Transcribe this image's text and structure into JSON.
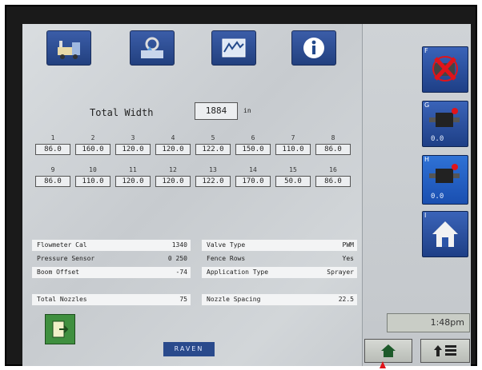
{
  "tabs": [
    {
      "name": "tab-machine",
      "icon": "machine-icon"
    },
    {
      "name": "tab-product",
      "icon": "product-settings-icon"
    },
    {
      "name": "tab-graph",
      "icon": "graph-icon"
    },
    {
      "name": "tab-info",
      "icon": "info-icon"
    }
  ],
  "width": {
    "label": "Total Width",
    "value": "1884",
    "unit": "in"
  },
  "sections_top": {
    "indices": [
      "1",
      "2",
      "3",
      "4",
      "5",
      "6",
      "7",
      "8"
    ],
    "values": [
      "86.0",
      "160.0",
      "120.0",
      "120.0",
      "122.0",
      "150.0",
      "110.0",
      "86.0"
    ]
  },
  "sections_bottom": {
    "indices": [
      "9",
      "10",
      "11",
      "12",
      "13",
      "14",
      "15",
      "16"
    ],
    "values": [
      "86.0",
      "110.0",
      "120.0",
      "120.0",
      "122.0",
      "170.0",
      "50.0",
      "86.0"
    ]
  },
  "left_info": [
    {
      "label": "Flowmeter Cal",
      "value": "1340"
    },
    {
      "label": "Pressure Sensor",
      "value": "0 250"
    },
    {
      "label": "Boom Offset",
      "value": "-74"
    },
    {
      "label": "Total Nozzles",
      "value": "75"
    }
  ],
  "right_info": [
    {
      "label": "Valve Type",
      "value": "PWM"
    },
    {
      "label": "Fence Rows",
      "value": "Yes"
    },
    {
      "label": "Application Type",
      "value": "Sprayer"
    },
    {
      "label": "Nozzle Spacing",
      "value": "22.5"
    }
  ],
  "sidebar": {
    "buttons": [
      {
        "letter": "F",
        "reading": ""
      },
      {
        "letter": "G",
        "reading": "0.0"
      },
      {
        "letter": "H",
        "reading": "0.0"
      },
      {
        "letter": "I",
        "reading": ""
      }
    ],
    "clock": "1:48pm"
  },
  "brand": "RAVEN",
  "colors": {
    "accent": "#2a4a8c",
    "cancel": "#e0141a",
    "exit": "#3f8f3f"
  }
}
